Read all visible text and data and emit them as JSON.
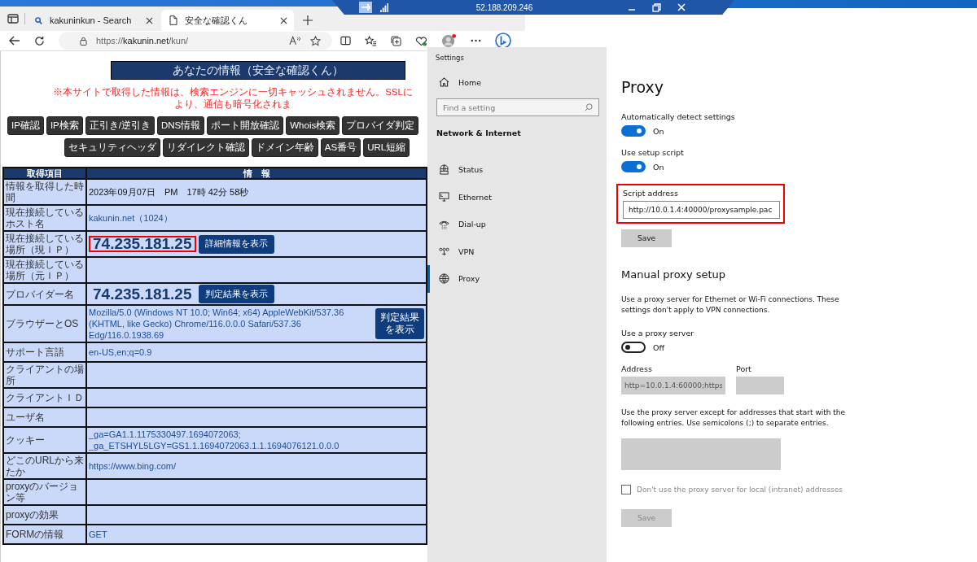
{
  "remote_bar": {
    "host": "52.188.209.246"
  },
  "browser": {
    "tabs": [
      {
        "title": "kakuninkun - Search",
        "selected": false
      },
      {
        "title": "安全な確認くん",
        "selected": true
      }
    ],
    "url": {
      "scheme": "https://",
      "domain": "kakunin.net",
      "path": "/kun/"
    }
  },
  "page": {
    "title": "あなたの情報（安全な確認くん）",
    "notice": "※本サイトで取得した情報は、検索エンジンに一切キャッシュされません。SSLにより、通信も暗号化されま",
    "nav_rows": [
      {
        "buttons": [
          "IP確認",
          "IP検索",
          "正引き/逆引き",
          "DNS情報",
          "ポート開放確認",
          "Whois検索",
          "プロバイダ判定"
        ]
      },
      {
        "buttons": [
          "セキュリティヘッダ",
          "リダイレクト確認",
          "ドメイン年齢",
          "AS番号",
          "URL短縮"
        ]
      }
    ],
    "table": {
      "columns": [
        "取得項目",
        "情　報"
      ],
      "rows": [
        {
          "label": "情報を取得した時間",
          "kind": "plain",
          "value": "2023年09月07日　PM　17時 42分 58秒"
        },
        {
          "label": "現在接続しているホスト名",
          "kind": "link",
          "value": "kakunin.net（1024）"
        },
        {
          "label": "現在接続している場所（現ＩＰ）",
          "kind": "ip",
          "value": "74.235.181.25",
          "highlighted": true,
          "button": "詳細情報を表示"
        },
        {
          "label": "現在接続している場所（元ＩＰ）",
          "kind": "empty"
        },
        {
          "label": "プロバイダー名",
          "kind": "ip",
          "value": "74.235.181.25",
          "highlighted": false,
          "button": "判定結果を表示"
        },
        {
          "label": "ブラウザーとOS",
          "kind": "link",
          "value": "Mozilla/5.0 (Windows NT 10.0; Win64; x64) AppleWebKit/537.36 (KHTML, like Gecko) Chrome/116.0.0.0 Safari/537.36 Edg/116.0.1938.69",
          "button": "判定結果を表示"
        },
        {
          "label": "サポート言語",
          "kind": "link",
          "value": "en-US,en;q=0.9"
        },
        {
          "label": "クライアントの場所",
          "kind": "empty"
        },
        {
          "label": "クライアントＩＤ",
          "kind": "empty"
        },
        {
          "label": "ユーザ名",
          "kind": "empty"
        },
        {
          "label": "クッキー",
          "kind": "link",
          "value": "_ga=GA1.1.1175330497.1694072063; _ga_ETSHYL5LGY=GS1.1.1694072063.1.1.1694076121.0.0.0"
        },
        {
          "label": "どこのURLから来たか",
          "kind": "link",
          "value": "https://www.bing.com/"
        },
        {
          "label": "proxyのバージョン等",
          "kind": "empty"
        },
        {
          "label": "proxyの効果",
          "kind": "empty"
        },
        {
          "label": "FORMの情報",
          "kind": "link",
          "value": "GET"
        }
      ]
    }
  },
  "settings": {
    "window_title": "Settings",
    "home": "Home",
    "search_placeholder": "Find a setting",
    "section": "Network & Internet",
    "nav": [
      {
        "label": "Status",
        "selected": false
      },
      {
        "label": "Ethernet",
        "selected": false
      },
      {
        "label": "Dial-up",
        "selected": false
      },
      {
        "label": "VPN",
        "selected": false
      },
      {
        "label": "Proxy",
        "selected": true
      }
    ],
    "page_title": "Proxy",
    "automatic": {
      "toggles": [
        {
          "label": "Automatically detect settings",
          "on": true,
          "state_text": "On"
        },
        {
          "label": "Use setup script",
          "on": true,
          "state_text": "On"
        }
      ],
      "script_address": {
        "label": "Script address",
        "value": "http://10.0.1.4:40000/proxysample.pac",
        "highlighted": true
      },
      "save": {
        "label": "Save",
        "disabled": false
      }
    },
    "manual": {
      "title": "Manual proxy setup",
      "description": "Use a proxy server for Ethernet or Wi-Fi connections. These settings don't apply to VPN connections.",
      "toggle": {
        "label": "Use a proxy server",
        "on": false,
        "state_text": "Off"
      },
      "address": {
        "label": "Address",
        "value": "http=10.0.1.4:60000;https",
        "disabled": true
      },
      "port": {
        "label": "Port",
        "disabled": true
      },
      "exceptions": {
        "description": "Use the proxy server except for addresses that start with the following entries. Use semicolons (;) to separate entries.",
        "disabled": true
      },
      "local_checkbox": {
        "label": "Don't use the proxy server for local (intranet) addresses",
        "checked": false,
        "disabled": true
      },
      "save": {
        "label": "Save",
        "disabled": true
      }
    }
  }
}
